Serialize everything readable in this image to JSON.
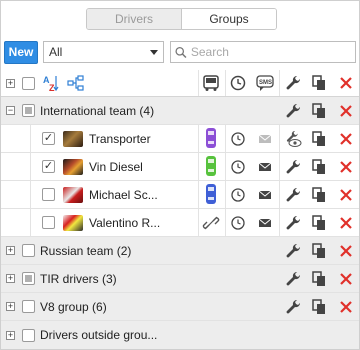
{
  "tabs": [
    {
      "label": "Drivers",
      "active": false
    },
    {
      "label": "Groups",
      "active": true
    }
  ],
  "toolbar": {
    "new_label": "New",
    "filter_value": "All",
    "search_placeholder": "Search"
  },
  "groups": [
    {
      "name": "International team (4)",
      "expanded": true
    },
    {
      "name": "Russian team (2)"
    },
    {
      "name": "TIR drivers (3)"
    },
    {
      "name": "V8 group (6)"
    },
    {
      "name": "Drivers outside grou..."
    }
  ],
  "drivers": [
    {
      "name": "Transporter",
      "checked": true,
      "car_color": "#8c4fd6"
    },
    {
      "name": "Vin Diesel",
      "checked": true,
      "car_color": "#57c23d"
    },
    {
      "name": "Michael Sc...",
      "checked": false,
      "car_color": "#3f5fd6"
    },
    {
      "name": "Valentino R...",
      "checked": false
    }
  ],
  "colors": {
    "accent": "#2f8de4",
    "delete": "#e0302a",
    "sort_red": "#d9302c",
    "sort_blue": "#2f7fd4"
  }
}
